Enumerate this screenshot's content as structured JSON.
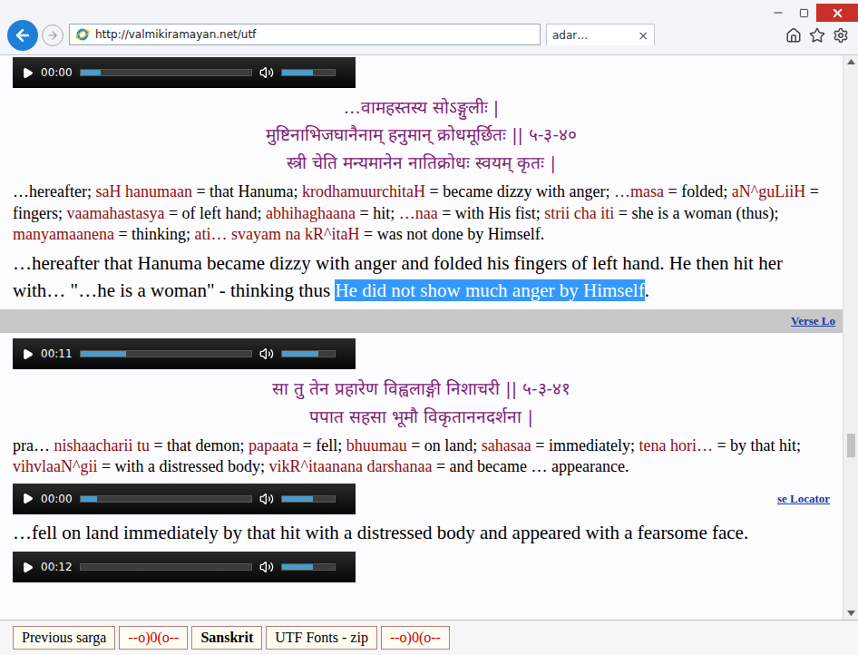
{
  "browser": {
    "address": "http://valmikiramayan.net/utf",
    "tab_title": "adar…",
    "tab_close": "×"
  },
  "sections": [
    {
      "kind": "player",
      "time": "00:00",
      "level": 0.12,
      "volume": 0.6,
      "link": ""
    },
    {
      "kind": "sanskrit",
      "lines": [
        "…वामहस्तस्य सोऽङ्गुलीः |",
        "मुष्टिनाभिजघानैनाम् हनुमान् क्रोधमूर्छितः || ५-३-४०",
        "स्त्री चेति मन्यमानेन नातिक्रोधः स्वयम् कृतः |"
      ]
    },
    {
      "kind": "gloss",
      "segments": [
        {
          "text": "…hereafter; ",
          "kind": "meaning"
        },
        {
          "text": "saH hanumaan",
          "kind": "term"
        },
        {
          "text": " = that Hanuma; ",
          "kind": "meaning"
        },
        {
          "text": "krodhamuurchitaH",
          "kind": "term"
        },
        {
          "text": " = became dizzy with anger; ",
          "kind": "meaning"
        },
        {
          "text": "…masa",
          "kind": "term"
        },
        {
          "text": " = folded; ",
          "kind": "meaning"
        },
        {
          "text": "aN^guLiiH",
          "kind": "term"
        },
        {
          "text": " = fingers; ",
          "kind": "meaning"
        },
        {
          "text": "vaamahastasya",
          "kind": "term"
        },
        {
          "text": " = of left hand; ",
          "kind": "meaning"
        },
        {
          "text": "abhihaghaana",
          "kind": "term"
        },
        {
          "text": " = hit; ",
          "kind": "meaning"
        },
        {
          "text": "…naa",
          "kind": "term"
        },
        {
          "text": " = with His fist; ",
          "kind": "meaning"
        },
        {
          "text": "strii cha iti",
          "kind": "term"
        },
        {
          "text": " = she is a woman (thus); ",
          "kind": "meaning"
        },
        {
          "text": "manyamaanena",
          "kind": "term"
        },
        {
          "text": " = thinking; ",
          "kind": "meaning"
        },
        {
          "text": "ati…",
          "kind": "term"
        },
        {
          "text": " ",
          "kind": "meaning"
        },
        {
          "text": "svayam na kR^itaH",
          "kind": "term"
        },
        {
          "text": " = was not done by Himself.",
          "kind": "meaning"
        }
      ]
    },
    {
      "kind": "translation",
      "segments": [
        {
          "text": "…hereafter that Hanuma became dizzy with anger and folded his fingers of left hand. He then hit her with… \"…he is a woman\" - thinking thus ",
          "selected": false
        },
        {
          "text": "He did not show much anger by Himself",
          "selected": true
        },
        {
          "text": ".",
          "selected": false
        }
      ]
    },
    {
      "kind": "locator",
      "label": "Verse Lo"
    },
    {
      "kind": "player",
      "time": "00:11",
      "level": 0.27,
      "volume": 0.7,
      "link": ""
    },
    {
      "kind": "sanskrit",
      "lines": [
        "सा तु तेन प्रहारेण विह्वलाङ्गी निशाचरी || ५-३-४१",
        "पपात सहसा भूमौ विकृताननदर्शना |"
      ]
    },
    {
      "kind": "gloss",
      "segments": [
        {
          "text": "pra… ",
          "kind": "meaning"
        },
        {
          "text": "nishaacharii tu",
          "kind": "term"
        },
        {
          "text": " = that demon; ",
          "kind": "meaning"
        },
        {
          "text": "papaata",
          "kind": "term"
        },
        {
          "text": " = fell; ",
          "kind": "meaning"
        },
        {
          "text": "bhuumau",
          "kind": "term"
        },
        {
          "text": " = on land; ",
          "kind": "meaning"
        },
        {
          "text": "sahasaa",
          "kind": "term"
        },
        {
          "text": " = immediately; ",
          "kind": "meaning"
        },
        {
          "text": "tena hori…",
          "kind": "term"
        },
        {
          "text": " = by that hit; ",
          "kind": "meaning"
        },
        {
          "text": "vihvlaaN^gii",
          "kind": "term"
        },
        {
          "text": " = with a distressed body; ",
          "kind": "meaning"
        },
        {
          "text": "vikR^itaanana darshanaa",
          "kind": "term"
        },
        {
          "text": " = and became … appearance.",
          "kind": "meaning"
        }
      ]
    },
    {
      "kind": "player",
      "time": "00:00",
      "level": 0.1,
      "volume": 0.6,
      "link": "se Locator"
    },
    {
      "kind": "translation",
      "segments": [
        {
          "text": "…fell on land immediately by that hit with a distressed body and appeared with a fearsome face.",
          "selected": false
        }
      ]
    },
    {
      "kind": "player",
      "time": "00:12",
      "level": 0.0,
      "volume": 0.6,
      "link": ""
    }
  ],
  "scrollbar": {
    "level": 0.72
  },
  "nav": [
    {
      "label": "Previous sarga",
      "selected": false,
      "color": "#000000"
    },
    {
      "label": "--o)0(o--",
      "selected": false,
      "color": "#cc0000"
    },
    {
      "label": "Sanskrit",
      "selected": true,
      "color": "#000000"
    },
    {
      "label": "UTF Fonts - zip",
      "selected": false,
      "color": "#000000"
    },
    {
      "label": "--o)0(o--",
      "selected": false,
      "color": "#cc0000"
    }
  ]
}
